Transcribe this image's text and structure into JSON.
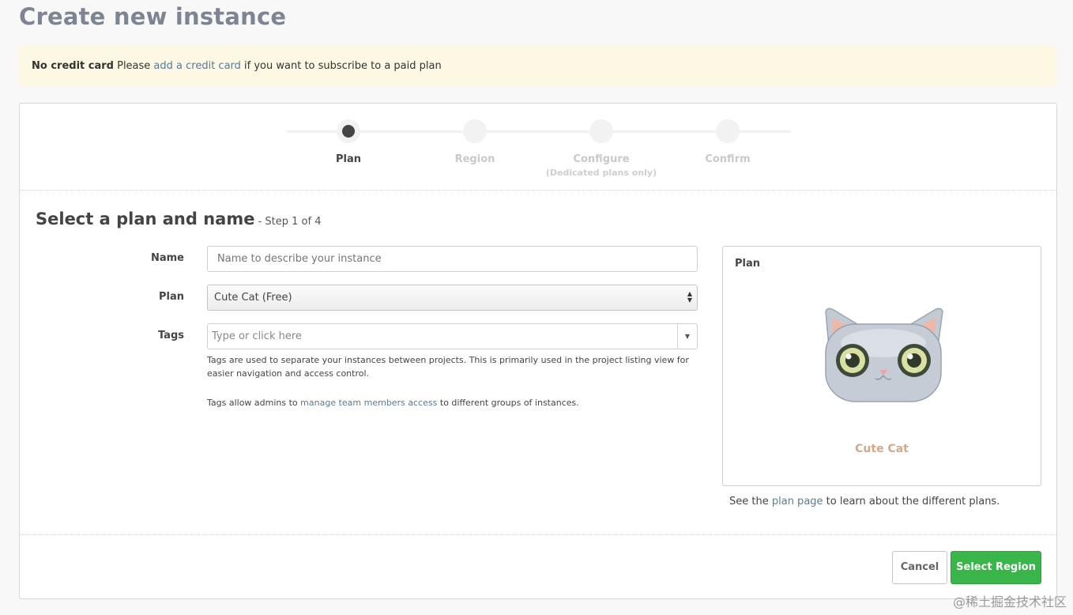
{
  "page": {
    "title": "Create new instance"
  },
  "alert": {
    "strong": "No credit card",
    "pre": " Please ",
    "link": "add a credit card",
    "post": " if you want to subscribe to a paid plan"
  },
  "wizard": {
    "steps": [
      {
        "label": "Plan",
        "sub": "",
        "active": true
      },
      {
        "label": "Region",
        "sub": "",
        "active": false
      },
      {
        "label": "Configure",
        "sub": "(Dedicated plans only)",
        "active": false
      },
      {
        "label": "Confirm",
        "sub": "",
        "active": false
      }
    ]
  },
  "section": {
    "title": "Select a plan and name",
    "step_info": " - Step 1 of 4"
  },
  "form": {
    "name_label": "Name",
    "name_placeholder": "Name to describe your instance",
    "name_value": "",
    "plan_label": "Plan",
    "plan_value": "Cute Cat (Free)",
    "tags_label": "Tags",
    "tags_placeholder": "Type or click here",
    "help1": "Tags are used to separate your instances between projects. This is primarily used in the project listing view for easier navigation and access control.",
    "help2_pre": "Tags allow admins to ",
    "help2_link": "manage team members access",
    "help2_post": " to different groups of instances."
  },
  "plan_panel": {
    "title": "Plan",
    "plan_name": "Cute Cat",
    "note_pre": "See the ",
    "note_link": "plan page",
    "note_post": " to learn about the different plans."
  },
  "footer": {
    "cancel_label": "Cancel",
    "primary_label": "Select Region"
  },
  "watermark": "@稀土掘金技术社区",
  "colors": {
    "accent_link": "#587b98",
    "primary_button": "#39b54a",
    "alert_bg": "#fcf8e3",
    "plan_name": "#d6a88a"
  }
}
